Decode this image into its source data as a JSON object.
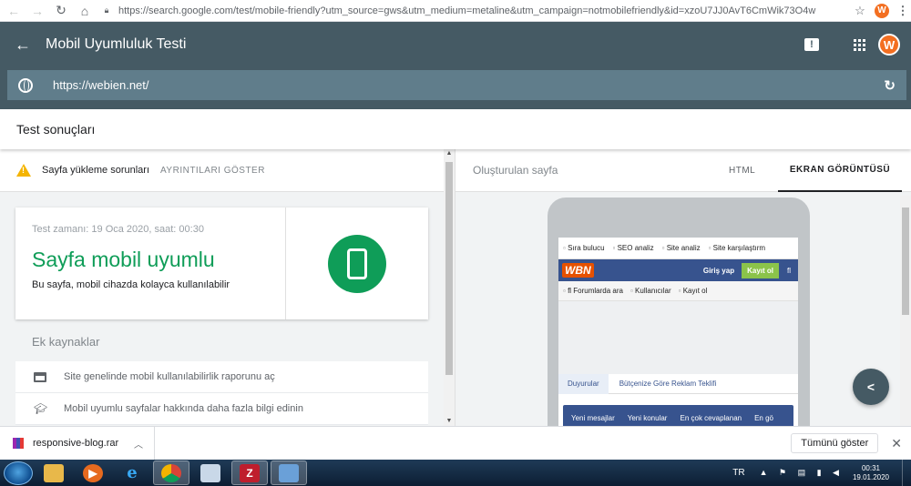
{
  "browser": {
    "url_host": "https://search.google.com",
    "url_path": "/test/mobile-friendly?utm_source=gws&utm_medium=metaline&utm_campaign=notmobilefriendly&id=xzoU7JJ0AvT6CmWik73O4w",
    "extension_letter": "W"
  },
  "app": {
    "title": "Mobil Uyumluluk Testi",
    "avatar_letter": "W",
    "tested_url": "https://webien.net/"
  },
  "results": {
    "title": "Test sonuçları",
    "issues_label": "Sayfa yükleme sorunları",
    "issues_link": "AYRINTILARI GÖSTER",
    "test_time": "Test zamanı: 19 Oca 2020, saat: 00:30",
    "verdict": "Sayfa mobil uyumlu",
    "verdict_desc": "Bu sayfa, mobil cihazda kolayca kullanılabilir",
    "resources_title": "Ek kaynaklar",
    "resources": [
      {
        "label": "Site genelinde mobil kullanılabilirlik raporunu aç"
      },
      {
        "label": "Mobil uyumlu sayfalar hakkında daha fazla bilgi edinin"
      }
    ]
  },
  "preview": {
    "rendered_label": "Oluşturulan sayfa",
    "tab_html": "HTML",
    "tab_screenshot": "EKRAN GÖRÜNTÜSÜ",
    "site": {
      "top_menu": [
        "Sıra bulucu",
        "SEO analiz",
        "Site analiz",
        "Site karşılaştırm"
      ],
      "logo": "WBN",
      "login": "Giriş yap",
      "register": "Kayıt ol",
      "extra": "fl",
      "login_bar": [
        "fl Forumlarda ara",
        "Kullanıcılar",
        "Kayıt ol"
      ],
      "announce_tab1": "Duyurular",
      "announce_tab2": "Bütçenize Göre Reklam Teklifi",
      "bottom_tabs": [
        "Yeni mesajlar",
        "Yeni konular",
        "En çok cevaplanan",
        "En gö"
      ]
    }
  },
  "downloads": {
    "file_name": "responsive-blog.rar",
    "show_all": "Tümünü göster"
  },
  "taskbar": {
    "lang": "TR",
    "time": "00:31",
    "date": "19.01.2020"
  }
}
